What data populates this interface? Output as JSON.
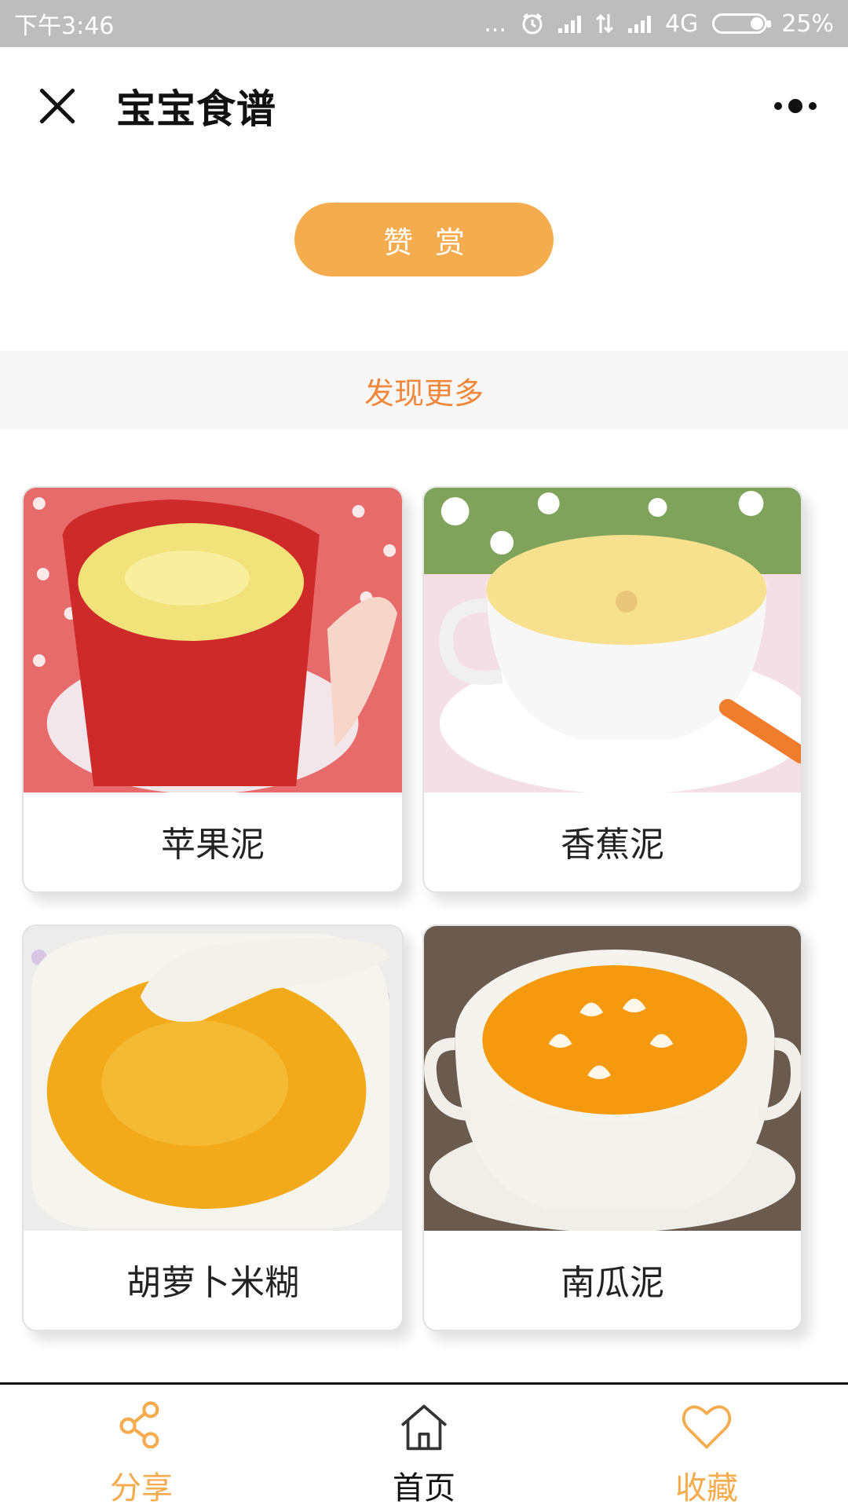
{
  "status_bar": {
    "time": "下午3:46",
    "dots": "...",
    "network": "4G",
    "battery": "25%",
    "battery_level": 0.25
  },
  "header": {
    "title": "宝宝食谱",
    "close_icon": "close-icon",
    "more_icon": "more-dots-icon"
  },
  "reward": {
    "label": "赞赏"
  },
  "discover": {
    "label": "发现更多"
  },
  "recipes": [
    {
      "name": "苹果泥",
      "image": "apple-puree-image"
    },
    {
      "name": "香蕉泥",
      "image": "banana-puree-image"
    },
    {
      "name": "胡萝卜米糊",
      "image": "carrot-rice-paste-image"
    },
    {
      "name": "南瓜泥",
      "image": "pumpkin-puree-image"
    }
  ],
  "bottom_nav": {
    "share": {
      "label": "分享",
      "icon": "share-icon"
    },
    "home": {
      "label": "首页",
      "icon": "home-icon"
    },
    "favorite": {
      "label": "收藏",
      "icon": "heart-icon"
    }
  },
  "colors": {
    "accent": "#f5ac4e",
    "discover_text": "#f0883c",
    "status_bar_bg": "#bdbdbd"
  }
}
